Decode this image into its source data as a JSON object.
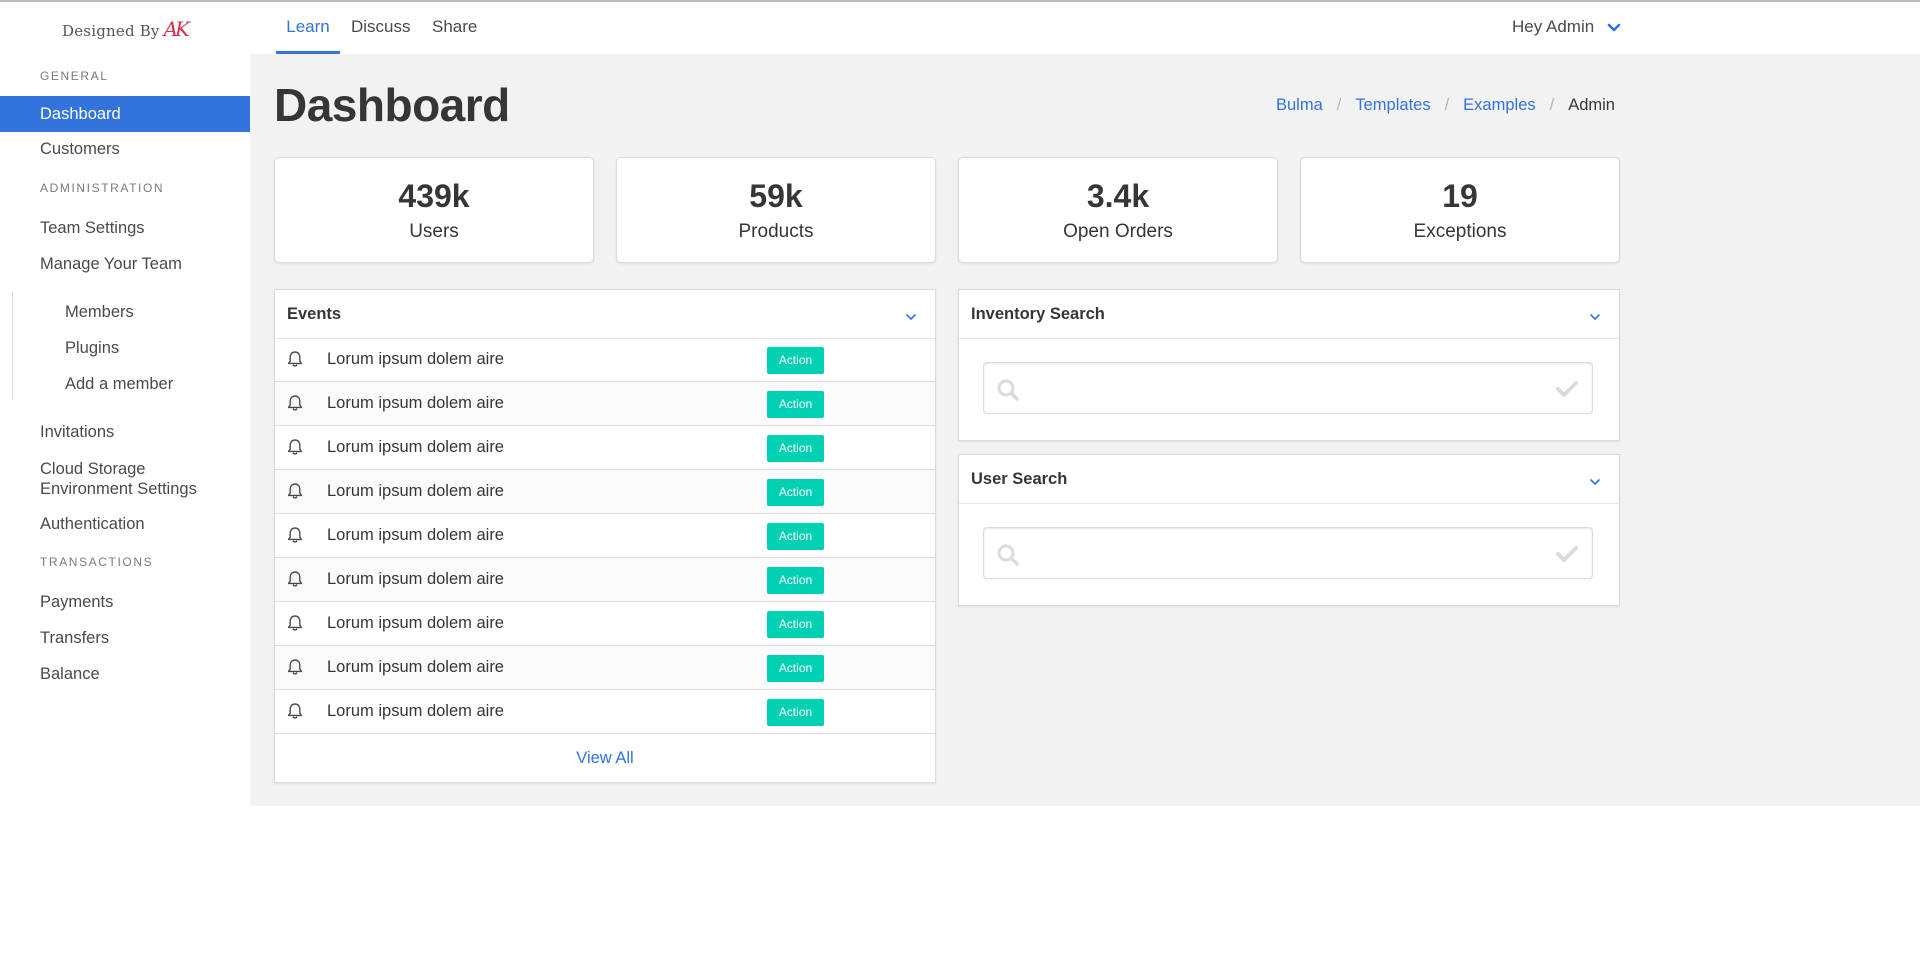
{
  "navbar": {
    "brand_text": "Designed By",
    "brand_logo": "AK",
    "links": [
      {
        "label": "Learn"
      },
      {
        "label": "Discuss"
      },
      {
        "label": "Share"
      }
    ],
    "user_label": "Hey Admin",
    "active_color": "#3273dc"
  },
  "sidebar": {
    "section_general": "General",
    "section_administration": "Administration",
    "section_transactions": "Transactions",
    "items": {
      "dashboard": "Dashboard",
      "customers": "Customers",
      "team_settings": "Team Settings",
      "manage_team": "Manage Your Team",
      "members": "Members",
      "plugins": "Plugins",
      "add_member": "Add a member",
      "invitations": "Invitations",
      "cloud_storage": "Cloud Storage Environment Settings",
      "authentication": "Authentication",
      "payments": "Payments",
      "transfers": "Transfers",
      "balance": "Balance"
    }
  },
  "page": {
    "title": "Dashboard",
    "breadcrumb": [
      "Bulma",
      "Templates",
      "Examples",
      "Admin"
    ]
  },
  "tiles": [
    {
      "value": "439k",
      "label": "Users"
    },
    {
      "value": "59k",
      "label": "Products"
    },
    {
      "value": "3.4k",
      "label": "Open Orders"
    },
    {
      "value": "19",
      "label": "Exceptions"
    }
  ],
  "events": {
    "title": "Events",
    "rows": [
      {
        "text": "Lorum ipsum dolem aire",
        "action": "Action"
      },
      {
        "text": "Lorum ipsum dolem aire",
        "action": "Action"
      },
      {
        "text": "Lorum ipsum dolem aire",
        "action": "Action"
      },
      {
        "text": "Lorum ipsum dolem aire",
        "action": "Action"
      },
      {
        "text": "Lorum ipsum dolem aire",
        "action": "Action"
      },
      {
        "text": "Lorum ipsum dolem aire",
        "action": "Action"
      },
      {
        "text": "Lorum ipsum dolem aire",
        "action": "Action"
      },
      {
        "text": "Lorum ipsum dolem aire",
        "action": "Action"
      },
      {
        "text": "Lorum ipsum dolem aire",
        "action": "Action"
      }
    ],
    "view_all": "View All",
    "action_color": "#00d1b2"
  },
  "inventory_search": {
    "title": "Inventory Search",
    "value": "",
    "placeholder": ""
  },
  "user_search": {
    "title": "User Search",
    "value": "",
    "placeholder": ""
  }
}
